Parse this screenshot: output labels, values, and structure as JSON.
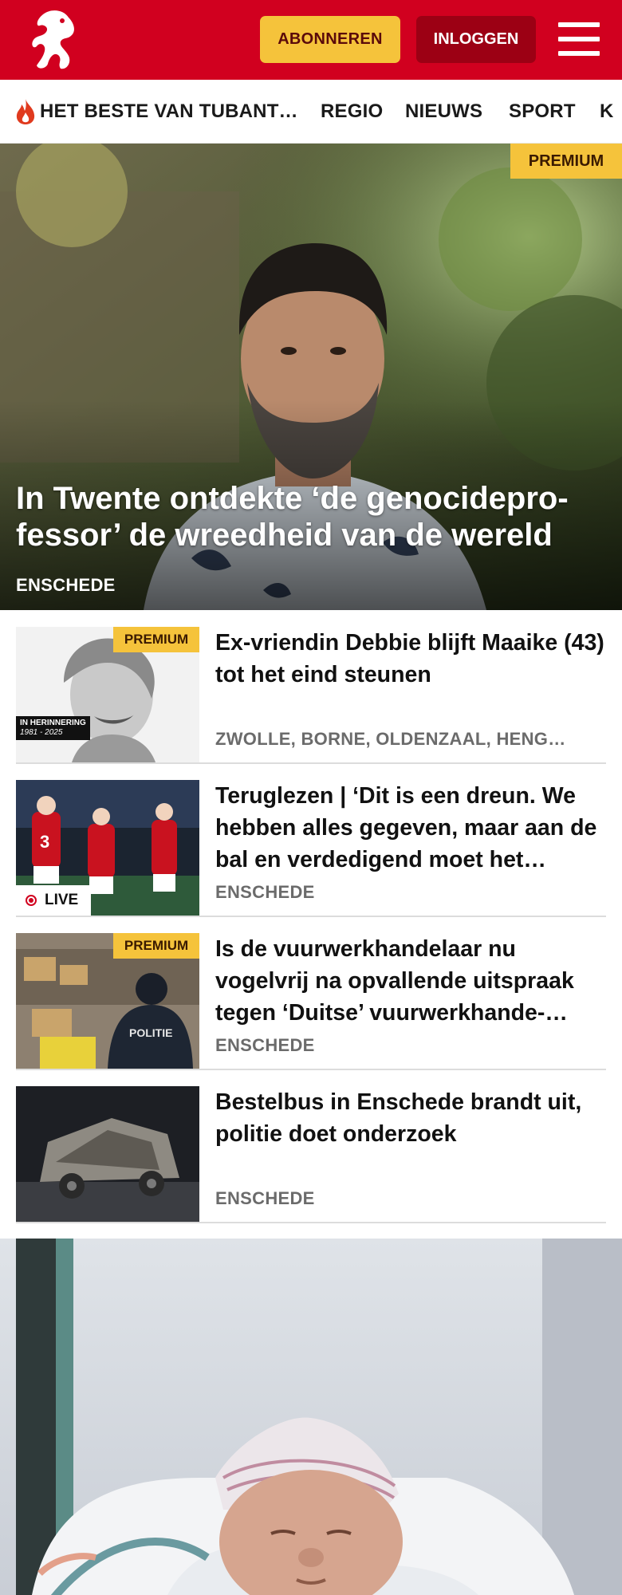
{
  "header": {
    "subscribe_label": "ABONNEREN",
    "login_label": "INLOGGEN",
    "brand_color": "#d1001f",
    "accent_color": "#f5c33b"
  },
  "nav": {
    "items": [
      {
        "label": "HET BESTE VAN TUBANT…",
        "icon": "flame-icon"
      },
      {
        "label": "REGIO"
      },
      {
        "label": "NIEUWS"
      },
      {
        "label": "SPORT"
      },
      {
        "label": "K"
      }
    ]
  },
  "hero": {
    "badge": "PREMIUM",
    "title": "In Twente ontdekte ‘de genocidepro-fessor’ de wreedheid van de wereld",
    "location": "ENSCHEDE"
  },
  "articles": [
    {
      "title": "Ex-vriendin Debbie blijft Maaike (43) tot het eind steunen",
      "location": "ZWOLLE, BORNE, OLDENZAAL, HENG…",
      "badge": "PREMIUM",
      "memorial": "IN HERINNERING",
      "memorial_years": "1981 - 2025"
    },
    {
      "title": "Teruglezen | ‘Dit is een dreun. We hebben alles gegeven, maar aan de bal en verdedigend moet het…",
      "location": "ENSCHEDE",
      "badge": "LIVE"
    },
    {
      "title": "Is de vuurwerkhandelaar nu vogelvrij na opvallende uitspraak tegen ‘Duitse’ vuurwerkhande-…",
      "location": "ENSCHEDE",
      "badge": "PREMIUM",
      "photo_text": "POLITIE"
    },
    {
      "title": "Bestelbus in Enschede brandt uit, politie doet onderzoek",
      "location": "ENSCHEDE"
    }
  ]
}
